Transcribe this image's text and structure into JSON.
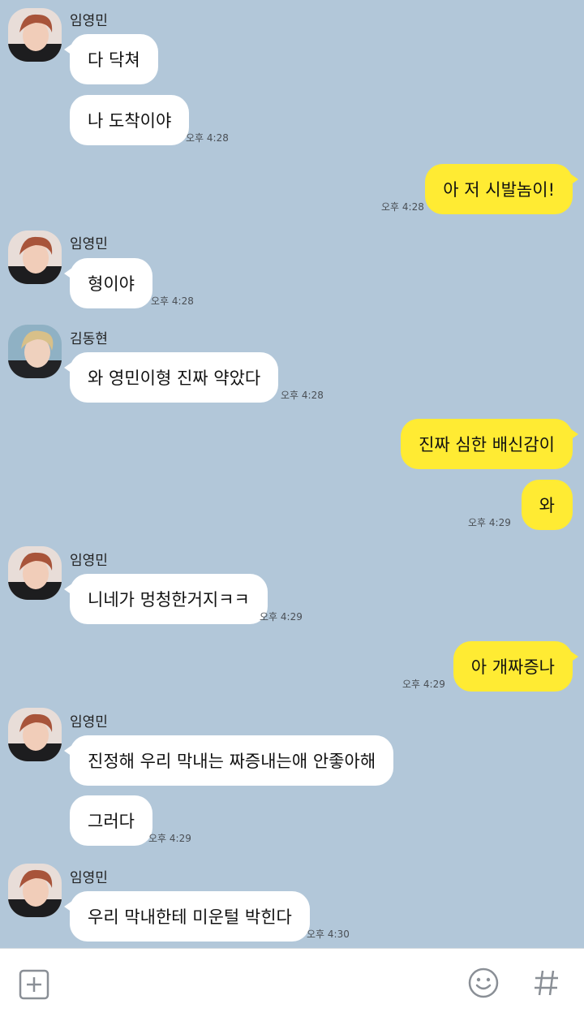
{
  "colors": {
    "background": "#b2c7d9",
    "incoming": "#ffffff",
    "outgoing": "#ffeb33"
  },
  "senders": {
    "a": "임영민",
    "b": "김동현"
  },
  "messages": {
    "m1": "다 닥쳐",
    "m2": "나 도착이야",
    "m3": "아 저 시발놈이!",
    "m4": "형이야",
    "m5": "와 영민이형 진짜 약았다",
    "m6": "진짜 심한 배신감이",
    "m7": "와",
    "m8": "니네가 멍청한거지ㅋㅋ",
    "m9": "아 개짜증나",
    "m10": "진정해 우리 막내는 짜증내는애 안좋아해",
    "m11": "그러다",
    "m12": "우리 막내한테 미운털 박힌다"
  },
  "times": {
    "t1": "오후 4:28",
    "t2": "오후 4:28",
    "t3": "오후 4:28",
    "t4": "오후 4:28",
    "t5": "오후 4:29",
    "t6": "오후 4:29",
    "t7": "오후 4:29",
    "t8": "오후 4:29",
    "t9": "오후 4:30"
  },
  "input_bar": {
    "icons": [
      "plus-icon",
      "emoji-icon",
      "hashtag-icon"
    ]
  }
}
